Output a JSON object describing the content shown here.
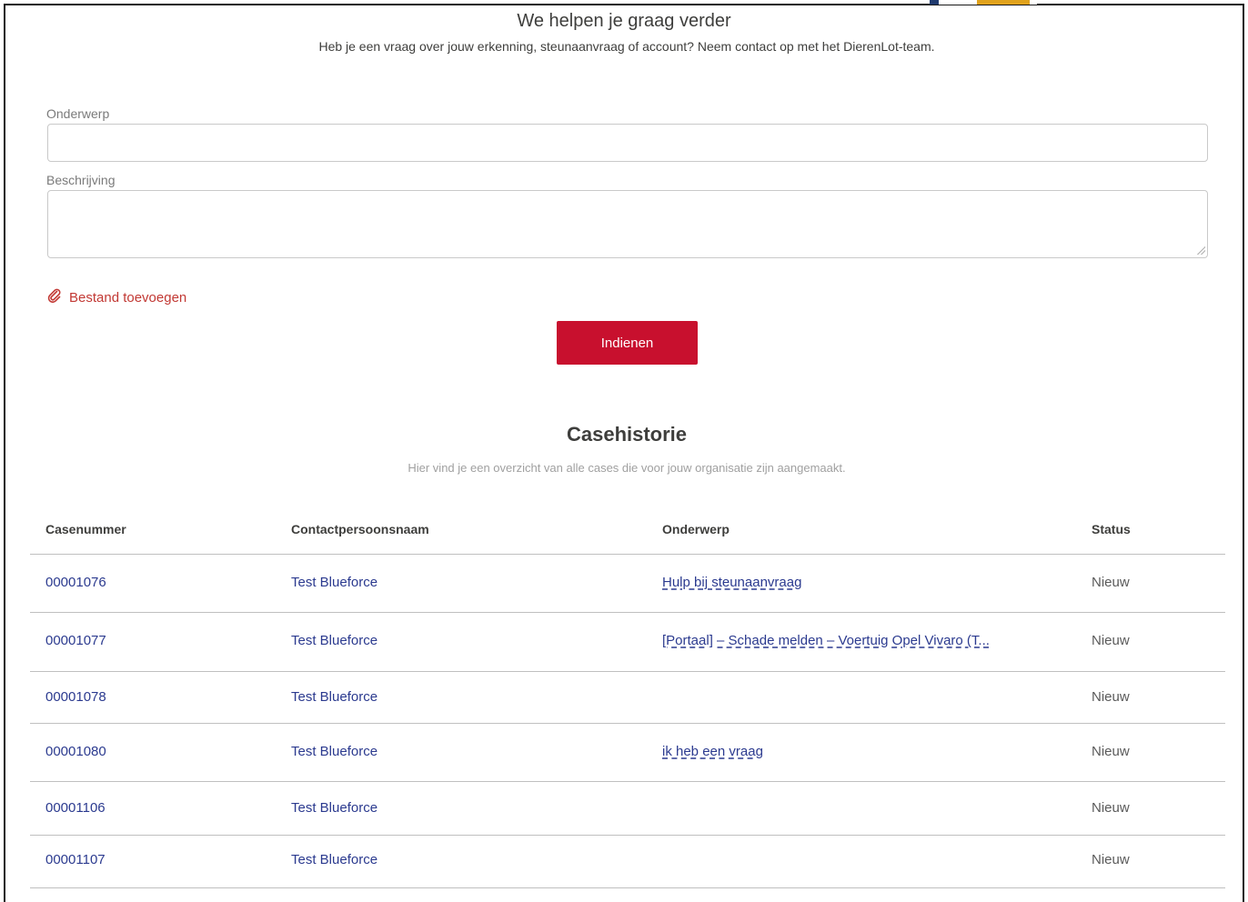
{
  "header": {
    "title": "We helpen je graag verder",
    "subtitle": "Heb je een vraag over jouw erkenning, steunaanvraag of account? Neem contact op met het DierenLot-team."
  },
  "form": {
    "subject_label": "Onderwerp",
    "subject_value": "",
    "description_label": "Beschrijving",
    "description_value": "",
    "attach_label": "Bestand toevoegen",
    "attach_icon": "paperclip-icon",
    "submit_label": "Indienen"
  },
  "case_history": {
    "title": "Casehistorie",
    "subtitle": "Hier vind je een overzicht van alle cases die voor jouw organisatie zijn aangemaakt.",
    "columns": [
      "Casenummer",
      "Contactpersoonsnaam",
      "Onderwerp",
      "Status"
    ],
    "rows": [
      {
        "number": "00001076",
        "contact": "Test Blueforce",
        "subject": "Hulp bij steunaanvraag",
        "status": "Nieuw"
      },
      {
        "number": "00001077",
        "contact": "Test Blueforce",
        "subject": "[Portaal] – Schade melden – Voertuig Opel Vivaro (T...",
        "status": "Nieuw"
      },
      {
        "number": "00001078",
        "contact": "Test Blueforce",
        "subject": "",
        "status": "Nieuw"
      },
      {
        "number": "00001080",
        "contact": "Test Blueforce",
        "subject": "ik heb een vraag",
        "status": "Nieuw"
      },
      {
        "number": "00001106",
        "contact": "Test Blueforce",
        "subject": "",
        "status": "Nieuw"
      },
      {
        "number": "00001107",
        "contact": "Test Blueforce",
        "subject": "",
        "status": "Nieuw"
      }
    ]
  },
  "colors": {
    "accent_red": "#c8102e",
    "link_blue": "#2b3a8f",
    "text": "#3e3e3c"
  }
}
